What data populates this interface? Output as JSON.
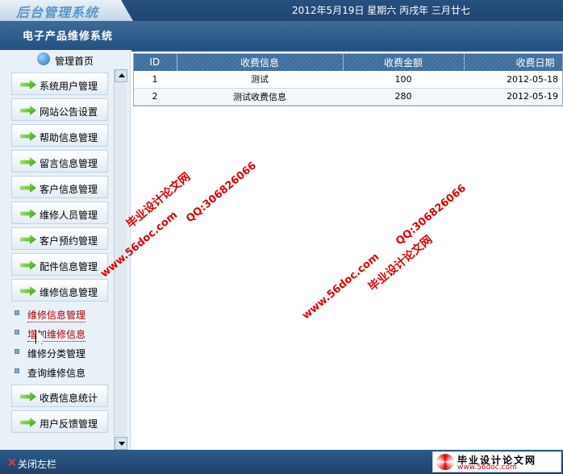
{
  "header": {
    "logo": "后台管理系统",
    "date": "2012年5月19日 星期六 丙戌年 三月廿七",
    "system_title": "电子产品维修系统"
  },
  "sidebar": {
    "home_label": "管理首页",
    "items": [
      {
        "label": "系统用户管理"
      },
      {
        "label": "网站公告设置"
      },
      {
        "label": "帮助信息管理"
      },
      {
        "label": "留言信息管理"
      },
      {
        "label": "客户信息管理"
      },
      {
        "label": "维修人员管理"
      },
      {
        "label": "客户预约管理"
      },
      {
        "label": "配件信息管理"
      },
      {
        "label": "维修信息管理"
      }
    ],
    "subitems": [
      {
        "label": "维修信息管理",
        "active": true
      },
      {
        "label": "增加维修信息",
        "active": true
      },
      {
        "label": "维修分类管理"
      },
      {
        "label": "查询维修信息"
      }
    ],
    "items_after": [
      {
        "label": "收费信息统计"
      },
      {
        "label": "用户反馈管理"
      }
    ]
  },
  "table": {
    "columns": [
      "ID",
      "收费信息",
      "收费金额",
      "收费日期"
    ],
    "rows": [
      [
        "1",
        "测试",
        "100",
        "2012-05-18"
      ],
      [
        "2",
        "测试收费信息",
        "280",
        "2012-05-19"
      ]
    ]
  },
  "watermarks": {
    "left_top": "毕业设计论文网",
    "left_url": "www.56doc.com",
    "left_qq": "QQ:306826066",
    "right_url": "www.56doc.com",
    "right_qq": "QQ:306826066",
    "right_title": "毕业设计论文网"
  },
  "footer": {
    "close_label": "关闭左栏",
    "brand_title": "毕业设计论文网",
    "brand_url": "www.56doc.com"
  },
  "colors": {
    "header_bg": "#1f4470",
    "table_header_bg": "#4b7aa8",
    "watermark": "#e00000"
  }
}
